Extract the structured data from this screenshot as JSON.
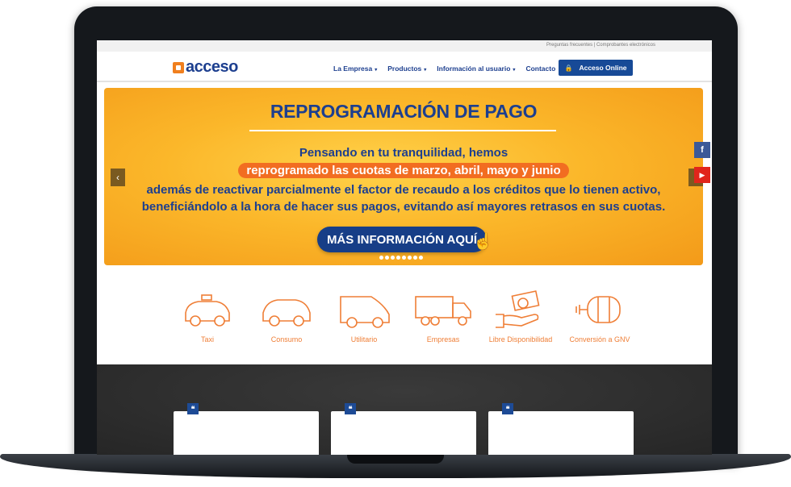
{
  "topbar": {
    "links": "Preguntas frecuentes | Comprobantes electrónicos"
  },
  "header": {
    "logo_text": "acceso",
    "nav": [
      {
        "label": "La Empresa",
        "caret": "▾"
      },
      {
        "label": "Productos",
        "caret": "▾"
      },
      {
        "label": "Información al usuario",
        "caret": "▾"
      },
      {
        "label": "Contacto",
        "caret": ""
      }
    ],
    "online_button": "Acceso Online",
    "lock_icon": "🔒"
  },
  "hero": {
    "title": "REPROGRAMACIÓN DE PAGO",
    "line1": "Pensando en tu tranquilidad, hemos",
    "highlight": "reprogramado las cuotas de marzo, abril, mayo y junio",
    "line3": "además de reactivar parcialmente el factor de recaudo a los créditos que lo tienen activo,",
    "line4": "beneficiándolo a la hora de hacer sus pagos, evitando así mayores retrasos en sus cuotas.",
    "cta": "MÁS INFORMACIÓN AQUÍ",
    "prev": "‹",
    "next": "›",
    "slides": 8
  },
  "social": {
    "facebook": "f",
    "youtube": "▶"
  },
  "categories": [
    {
      "label": "Taxi",
      "icon": "taxi-icon"
    },
    {
      "label": "Consumo",
      "icon": "car-icon"
    },
    {
      "label": "Utilitario",
      "icon": "van-icon"
    },
    {
      "label": "Empresas",
      "icon": "truck-icon"
    },
    {
      "label": "Libre Disponibilidad",
      "icon": "money-hand-icon"
    },
    {
      "label": "Conversión a GNV",
      "icon": "gas-tank-icon"
    }
  ],
  "testimonials": {
    "quote_glyph": "❝"
  },
  "colors": {
    "brand_blue": "#1d3f8f",
    "brand_orange": "#f26d21",
    "hero_yellow": "#fbb72a"
  }
}
